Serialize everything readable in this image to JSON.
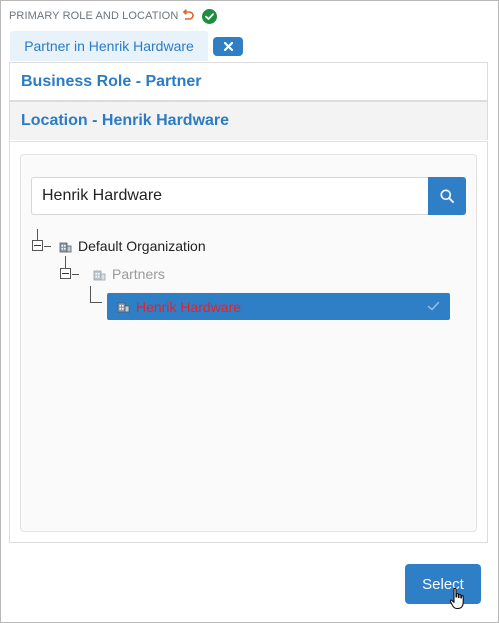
{
  "header": {
    "label": "PRIMARY ROLE AND LOCATION"
  },
  "chip": {
    "label": "Partner in Henrik Hardware"
  },
  "sections": {
    "business_role": "Business Role - Partner",
    "location": "Location - Henrik Hardware"
  },
  "search": {
    "value": "Henrik Hardware",
    "placeholder": ""
  },
  "tree": {
    "root": "Default Organization",
    "partners": "Partners",
    "selected": "Henrik Hardware"
  },
  "actions": {
    "select_label": "Select"
  },
  "colors": {
    "accent": "#2f7fc6",
    "link": "#2b7cc4",
    "success": "#1e8e3e",
    "undo": "#e0622d",
    "selected_text": "#e8202a"
  }
}
